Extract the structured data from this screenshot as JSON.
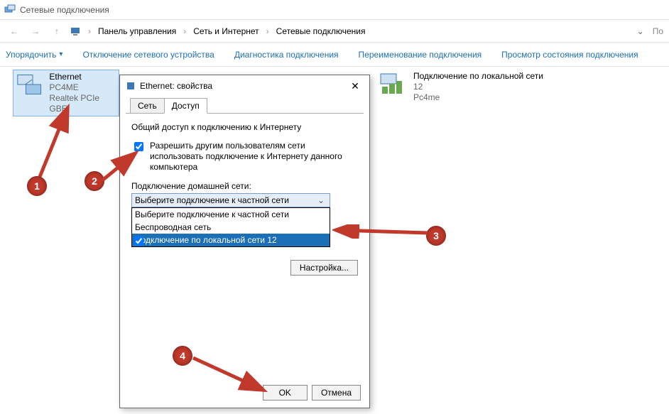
{
  "window": {
    "title": "Сетевые подключения"
  },
  "breadcrumb": {
    "items": [
      "Панель управления",
      "Сеть и Интернет",
      "Сетевые подключения"
    ],
    "search_prefix": "По"
  },
  "toolbar": {
    "organize": "Упорядочить",
    "disable": "Отключение сетевого устройства",
    "diagnose": "Диагностика подключения",
    "rename": "Переименование подключения",
    "status": "Просмотр состояния подключения"
  },
  "connections": {
    "ethernet": {
      "name": "Ethernet",
      "line2": "PC4ME",
      "line3": "Realtek PCIe GBE"
    },
    "lan": {
      "name": "Подключение по локальной сети",
      "line2": "12",
      "line3": "Pc4me"
    }
  },
  "dialog": {
    "title": "Ethernet: свойства",
    "tabs": {
      "network": "Сеть",
      "access": "Доступ"
    },
    "group_label": "Общий доступ к подключению к Интернету",
    "chk1": "Разрешить другим пользователям сети использовать подключение к Интернету данного компьютера",
    "home_net_label": "Подключение домашней сети:",
    "combo": {
      "selected": "Выберите подключение к частной сети",
      "options": [
        "Выберите подключение к частной сети",
        "Беспроводная сеть",
        "Подключение по локальной сети 12"
      ]
    },
    "configure": "Настройка...",
    "ok": "OK",
    "cancel": "Отмена"
  },
  "markers": {
    "m1": "1",
    "m2": "2",
    "m3": "3",
    "m4": "4"
  }
}
